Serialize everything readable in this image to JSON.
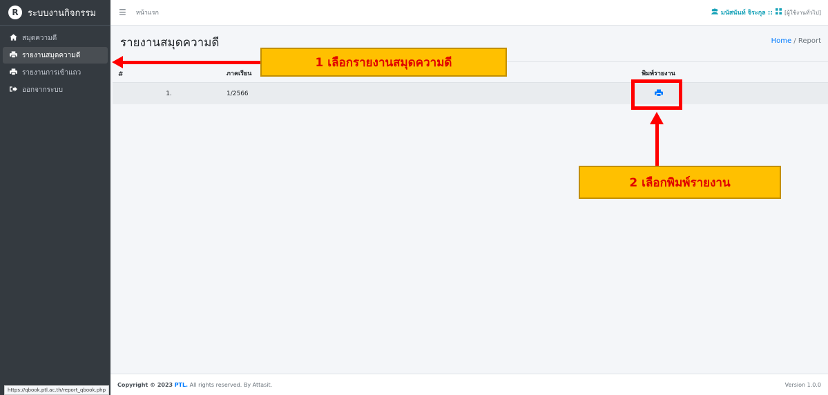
{
  "sidebar": {
    "brand": "ระบบงานกิจกรรม",
    "brand_logo": "R",
    "items": [
      {
        "label": "สมุดความดี",
        "icon": "home-icon"
      },
      {
        "label": "รายงานสมุดความดี",
        "icon": "print-icon"
      },
      {
        "label": "รายงานการเข้าแถว",
        "icon": "print-icon"
      },
      {
        "label": "ออกจากระบบ",
        "icon": "logout-icon"
      }
    ],
    "active_index": 1
  },
  "statusbar": {
    "url": "https://qbook.ptl.ac.th/report_qbook.php"
  },
  "topbar": {
    "home_link": "หน้าแรก",
    "user_name": "มนัสนันท์ จิระกุล ::",
    "role": "[ผู้ใช้งานทั่วไป]"
  },
  "header": {
    "title": "รายงานสมุดความดี",
    "breadcrumb_home": "Home",
    "breadcrumb_sep": "/",
    "breadcrumb_current": "Report"
  },
  "table": {
    "columns": [
      "#",
      "ภาคเรียน",
      "พิมพ์รายงาน"
    ],
    "rows": [
      {
        "num": "1.",
        "term": "1/2566"
      }
    ]
  },
  "annotations": {
    "step1": "1 เลือกรายงานสมุดความดี",
    "step2": "2 เลือกพิมพ์รายงาน"
  },
  "footer": {
    "copyright": "Copyright © 2023",
    "org": "PTL.",
    "rest": "All rights reserved. By Attasit.",
    "version": "Version 1.0.0"
  },
  "colors": {
    "sidebar_bg": "#343a40",
    "accent": "#007bff",
    "callout_bg": "#ffc000",
    "annotation_red": "#ff0000"
  }
}
